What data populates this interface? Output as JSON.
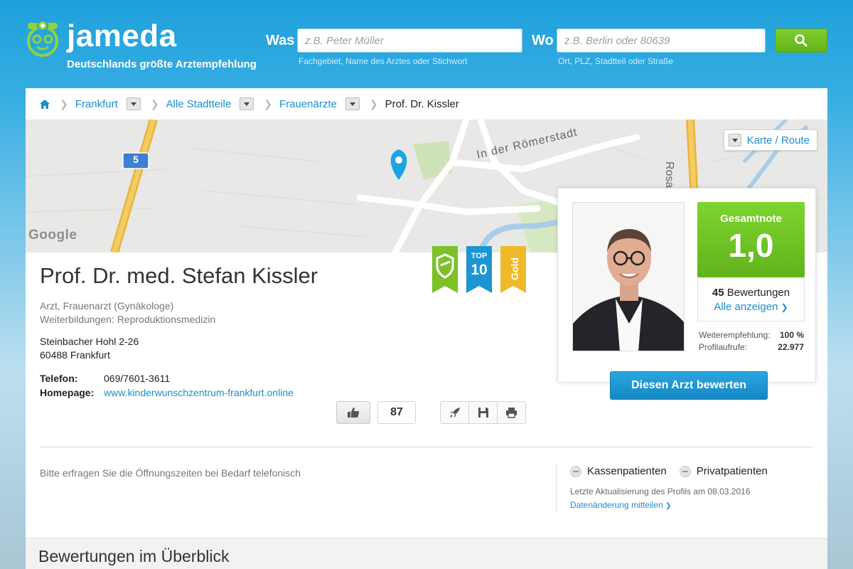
{
  "header": {
    "logo_text": "jameda",
    "claim": "Deutschlands größte Arztempfehlung",
    "search_what_label": "Was",
    "search_what_placeholder": "z.B. Peter Müller",
    "search_what_hint": "Fachgebiet, Name des Arztes oder Stichwort",
    "search_where_label": "Wo",
    "search_where_placeholder": "z.B. Berlin oder 80639",
    "search_where_hint": "Ort, PLZ, Stadtteil oder Straße",
    "search_button_icon": "magnifier-icon"
  },
  "breadcrumb": {
    "home_icon": "home-icon",
    "items": [
      "Frankfurt",
      "Alle Stadtteile",
      "Frauenärzte"
    ],
    "current": "Prof. Dr. Kissler"
  },
  "map": {
    "route_button": "Karte / Route",
    "street_label": "In der Römerstadt",
    "street_label_2": "Rosa-L",
    "highway_shield": "5",
    "attribution": "Google"
  },
  "doctor": {
    "name": "Prof. Dr. med. Stefan Kissler",
    "specialty": "Arzt, Frauenarzt (Gynäkologe)",
    "further_training": "Weiterbildungen: Reproduktionsmedizin",
    "street": "Steinbacher Hohl 2-26",
    "city": "60488 Frankfurt",
    "phone_label": "Telefon:",
    "phone": "069/7601-3611",
    "homepage_label": "Homepage:",
    "homepage": "www.kinderwunschzentrum-frankfurt.online"
  },
  "badges": {
    "top_label": "TOP",
    "top_value": "10",
    "gold_label": "Gold"
  },
  "actions": {
    "like_count": "87",
    "like_icon": "thumbs-up-icon",
    "tools": [
      "rocket-icon",
      "save-icon",
      "print-icon"
    ]
  },
  "rating": {
    "grade_label": "Gesamtnote",
    "grade_value": "1,0",
    "reviews_count": "45",
    "reviews_label": "Bewertungen",
    "reviews_link": "Alle anzeigen",
    "recommendation_label": "Weiterempfehlung:",
    "recommendation_value": "100 %",
    "views_label": "Profilaufrufe:",
    "views_value": "22.977",
    "rate_button": "Diesen Arzt bewerten"
  },
  "info": {
    "hours": "Bitte erfragen Sie die Öffnungszeiten bei Bedarf telefonisch",
    "insurance_public": "Kassenpatienten",
    "insurance_private": "Privatpatienten",
    "updated": "Letzte Aktualisierung des Profils am 08.03.2016",
    "report_link": "Datenänderung mitteilen"
  },
  "overview": {
    "title": "Bewertungen im Überblick"
  },
  "colors": {
    "header_blue": "#1fa0dc",
    "link_blue": "#1c8ec9",
    "grade_green": "#6cc024",
    "button_blue": "#1a94cf"
  }
}
